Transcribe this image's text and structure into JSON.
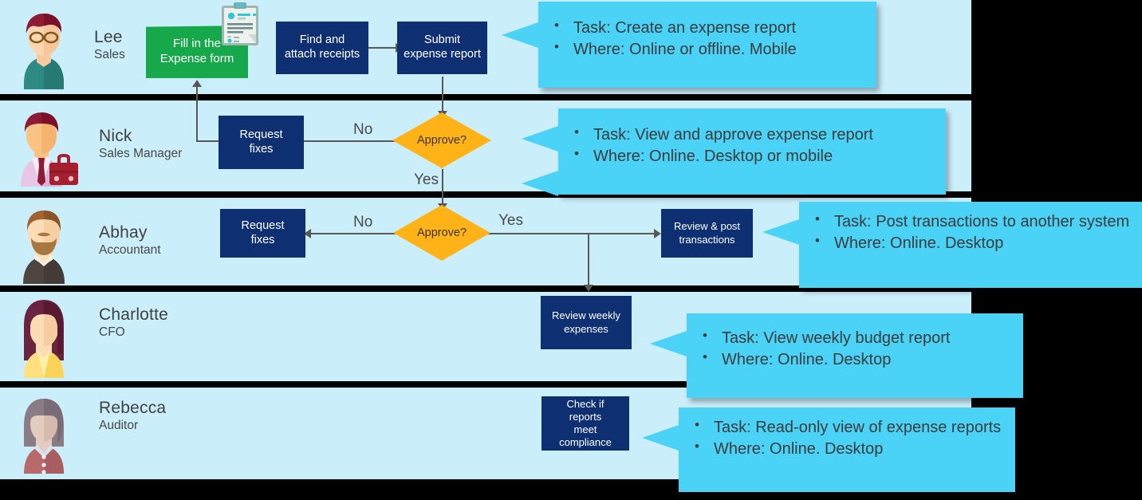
{
  "diagram": {
    "title": "Expense report process swimlane",
    "colors": {
      "lane_background": "#cbeefb",
      "page_background": "#000000",
      "process_box": "#0e3073",
      "start_box": "#17a84b",
      "decision": "#ffb316",
      "callout": "#4ad2f7",
      "connector": "#585858"
    }
  },
  "lanes": [
    {
      "id": "lane-lee",
      "actor": {
        "name": "Lee",
        "role": "Sales"
      },
      "avatar": "avatar-lee-icon"
    },
    {
      "id": "lane-nick",
      "actor": {
        "name": "Nick",
        "role": "Sales Manager"
      },
      "avatar": "avatar-nick-icon"
    },
    {
      "id": "lane-abhay",
      "actor": {
        "name": "Abhay",
        "role": "Accountant"
      },
      "avatar": "avatar-abhay-icon"
    },
    {
      "id": "lane-charlotte",
      "actor": {
        "name": "Charlotte",
        "role": "CFO"
      },
      "avatar": "avatar-charlotte-icon"
    },
    {
      "id": "lane-rebecca",
      "actor": {
        "name": "Rebecca",
        "role": "Auditor"
      },
      "avatar": "avatar-rebecca-icon"
    }
  ],
  "nodes": {
    "fill_form": "Fill in the\nExpense form",
    "fill_form_line1": "Fill in the",
    "fill_form_line2": "Expense form",
    "find_attach": "Find and attach receipts",
    "find_attach_line1": "Find and",
    "find_attach_line2": "attach receipts",
    "submit_report": "Submit expense report",
    "submit_report_line1": "Submit",
    "submit_report_line2": "expense report",
    "request_fixes_manager_line1": "Request",
    "request_fixes_manager_line2": "fixes",
    "request_fixes_accountant_line1": "Request",
    "request_fixes_accountant_line2": "fixes",
    "approve_manager": "Approve?",
    "approve_accountant": "Approve?",
    "review_post_line1": "Review & post",
    "review_post_line2": "transactions",
    "review_weekly_line1": "Review weekly",
    "review_weekly_line2": "expenses",
    "compliance_line1": "Check if",
    "compliance_line2": "reports",
    "compliance_line3": "meet",
    "compliance_line4": "compliance"
  },
  "edge_labels": {
    "manager_no": "No",
    "manager_yes": "Yes",
    "accountant_no": "No",
    "accountant_yes": "Yes"
  },
  "callouts": [
    {
      "id": "callout-lee",
      "lines": [
        "Task: Create an expense report",
        "Where: Online or offline. Mobile"
      ]
    },
    {
      "id": "callout-nick",
      "lines": [
        "Task: View and approve expense report",
        "Where: Online. Desktop or mobile"
      ]
    },
    {
      "id": "callout-abhay",
      "lines": [
        "Task: Post transactions to another system",
        "Where: Online. Desktop"
      ]
    },
    {
      "id": "callout-charlotte",
      "lines": [
        "Task: View weekly budget report",
        "Where: Online. Desktop"
      ]
    },
    {
      "id": "callout-rebecca",
      "lines": [
        "Task: Read-only view of expense reports",
        "Where: Online. Desktop"
      ]
    }
  ],
  "icons": {
    "clipboard": "clipboard-form-icon"
  }
}
